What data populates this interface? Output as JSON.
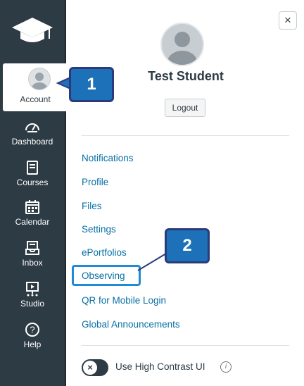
{
  "nav": {
    "account": {
      "label": "Account",
      "icon": "user-icon"
    },
    "items": [
      {
        "label": "Dashboard",
        "icon": "dashboard-icon"
      },
      {
        "label": "Courses",
        "icon": "book-icon"
      },
      {
        "label": "Calendar",
        "icon": "calendar-icon"
      },
      {
        "label": "Inbox",
        "icon": "inbox-icon"
      },
      {
        "label": "Studio",
        "icon": "studio-icon"
      },
      {
        "label": "Help",
        "icon": "help-icon"
      }
    ]
  },
  "tray": {
    "close_label": "×",
    "user_name": "Test Student",
    "logout_label": "Logout",
    "links": [
      "Notifications",
      "Profile",
      "Files",
      "Settings",
      "ePortfolios",
      "Observing",
      "QR for Mobile Login",
      "Global Announcements"
    ],
    "high_contrast_label": "Use High Contrast UI",
    "toggle_symbol": "×",
    "info_symbol": "i"
  },
  "callouts": {
    "one": "1",
    "two": "2"
  },
  "colors": {
    "nav_bg": "#2d3b45",
    "link": "#0770a3",
    "callout_fill": "#1d71b8",
    "callout_border": "#2b3a7a",
    "highlight": "#1f8bd6"
  }
}
